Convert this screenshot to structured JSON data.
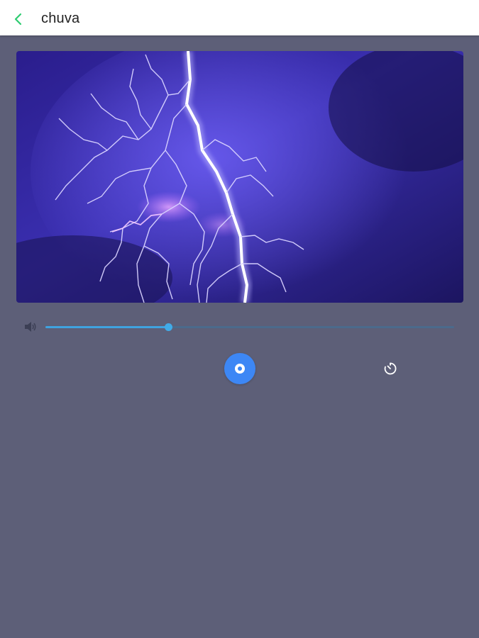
{
  "header": {
    "title": "chuva",
    "back_icon": "chevron-left-icon",
    "accent_color": "#2ecc71"
  },
  "artwork": {
    "subject": "lightning-storm-image"
  },
  "volume": {
    "icon": "volume-icon",
    "level": 0.3
  },
  "controls": {
    "play_icon": "play-circle-icon",
    "play_color": "#3d87f5",
    "timer_icon": "timer-icon"
  }
}
